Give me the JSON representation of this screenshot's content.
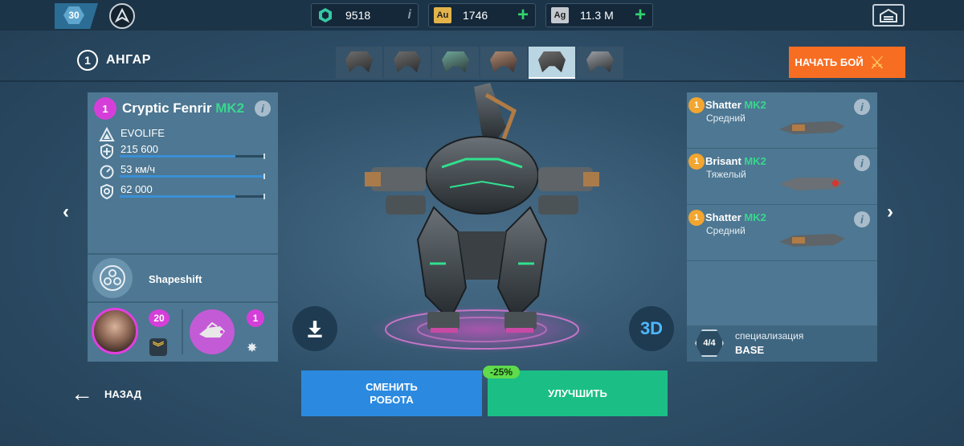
{
  "topbar": {
    "player_level": "30",
    "resources": [
      {
        "name": "platinum",
        "value": "9518",
        "icon": "platinum-hex-icon",
        "color": "#36c9a4",
        "action": "info"
      },
      {
        "name": "gold",
        "value": "1746",
        "icon": "Au",
        "color": "#e3b34a",
        "action": "add"
      },
      {
        "name": "silver",
        "value": "11.3 M",
        "icon": "Ag",
        "color": "#c4c9cf",
        "action": "add"
      }
    ]
  },
  "header": {
    "hangar_number": "1",
    "title": "АНГАР",
    "start_button": "НАЧАТЬ БОЙ"
  },
  "robot": {
    "level": "1",
    "name": "Cryptic Fenrir",
    "mark": "MK2",
    "manufacturer": "EVOLIFE",
    "health": "215 600",
    "speed": "53 км/ч",
    "shield": "62 000",
    "health_fill": 0.8,
    "speed_fill": 1.0,
    "shield_fill": 0.8,
    "ability": "Shapeshift",
    "pilot_level": "20",
    "drone_level": "1"
  },
  "weapons": [
    {
      "level": "1",
      "name": "Shatter",
      "mark": "MK2",
      "class": "Средний"
    },
    {
      "level": "1",
      "name": "Brisant",
      "mark": "MK2",
      "class": "Тяжелый"
    },
    {
      "level": "1",
      "name": "Shatter",
      "mark": "MK2",
      "class": "Средний"
    }
  ],
  "specialization": {
    "progress": "4/4",
    "label": "специализация",
    "value": "BASE"
  },
  "bottom": {
    "back_label": "НАЗАД",
    "change_robot": "СМЕНИТЬ РОБОТА",
    "upgrade": "УЛУЧШИТЬ",
    "discount": "-25%"
  },
  "view_toggle": "3D",
  "colors": {
    "accent_mk": "#3ad68f",
    "start_button": "#f76e23",
    "change_button": "#2b8ae0",
    "upgrade_button": "#1bbf85",
    "level_badge": "#d53fd9"
  }
}
